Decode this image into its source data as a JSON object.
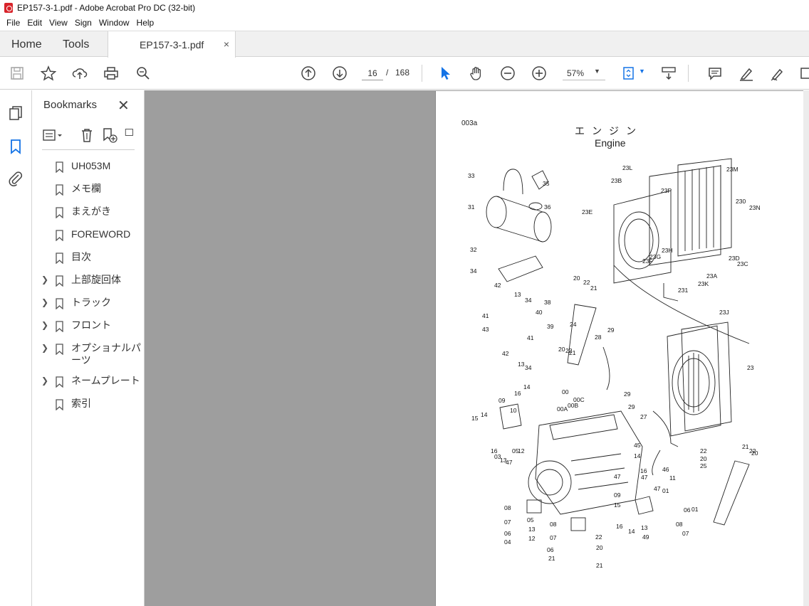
{
  "window": {
    "title": "EP157-3-1.pdf - Adobe Acrobat Pro DC (32-bit)"
  },
  "menu": [
    "File",
    "Edit",
    "View",
    "Sign",
    "Window",
    "Help"
  ],
  "tabs": {
    "home": "Home",
    "tools": "Tools",
    "document": "EP157-3-1.pdf",
    "close": "×"
  },
  "toolbar": {
    "current_page": "16",
    "separator": "/",
    "total_pages": "168",
    "zoom": "57%"
  },
  "bookmarks": {
    "title": "Bookmarks",
    "close": "✕",
    "items": [
      {
        "label": "UH053M",
        "expandable": false
      },
      {
        "label": "メモ欄",
        "expandable": false
      },
      {
        "label": "まえがき",
        "expandable": false
      },
      {
        "label": "FOREWORD",
        "expandable": false
      },
      {
        "label": "目次",
        "expandable": false
      },
      {
        "label": "上部旋回体",
        "expandable": true
      },
      {
        "label": "トラック",
        "expandable": true
      },
      {
        "label": "フロント",
        "expandable": true
      },
      {
        "label": "オプショナルパーツ",
        "expandable": true
      },
      {
        "label": "ネームプレート",
        "expandable": true
      },
      {
        "label": "索引",
        "expandable": false
      }
    ]
  },
  "document_page": {
    "code": "003a",
    "title_jp": "エンジン",
    "title_en": "Engine",
    "part_labels": [
      "33",
      "35",
      "36",
      "31",
      "32",
      "34",
      "42",
      "13",
      "34",
      "38",
      "41",
      "40",
      "39",
      "43",
      "41",
      "42",
      "13",
      "34",
      "23L",
      "23M",
      "23B",
      "23P",
      "23E",
      "230",
      "23N",
      "23H",
      "23F",
      "23G",
      "23D",
      "23C",
      "23A",
      "23K",
      "231",
      "23J",
      "20",
      "22",
      "21",
      "24",
      "28",
      "29",
      "20",
      "22",
      "21",
      "23",
      "29",
      "00",
      "00C",
      "00B",
      "00A",
      "29",
      "27",
      "14",
      "16",
      "09",
      "10",
      "15",
      "14",
      "16",
      "12",
      "03",
      "13",
      "05",
      "47",
      "45",
      "14",
      "16",
      "47",
      "47",
      "46",
      "11",
      "47",
      "01",
      "08",
      "07",
      "06",
      "04",
      "05",
      "13",
      "12",
      "09",
      "15",
      "16",
      "14",
      "13",
      "49",
      "08",
      "07",
      "06",
      "01",
      "08",
      "07",
      "06",
      "21",
      "22",
      "20",
      "21",
      "22",
      "20",
      "25",
      "21",
      "22",
      "20"
    ]
  },
  "colors": {
    "accent_blue": "#1473e6",
    "doc_background": "#9e9e9e"
  }
}
